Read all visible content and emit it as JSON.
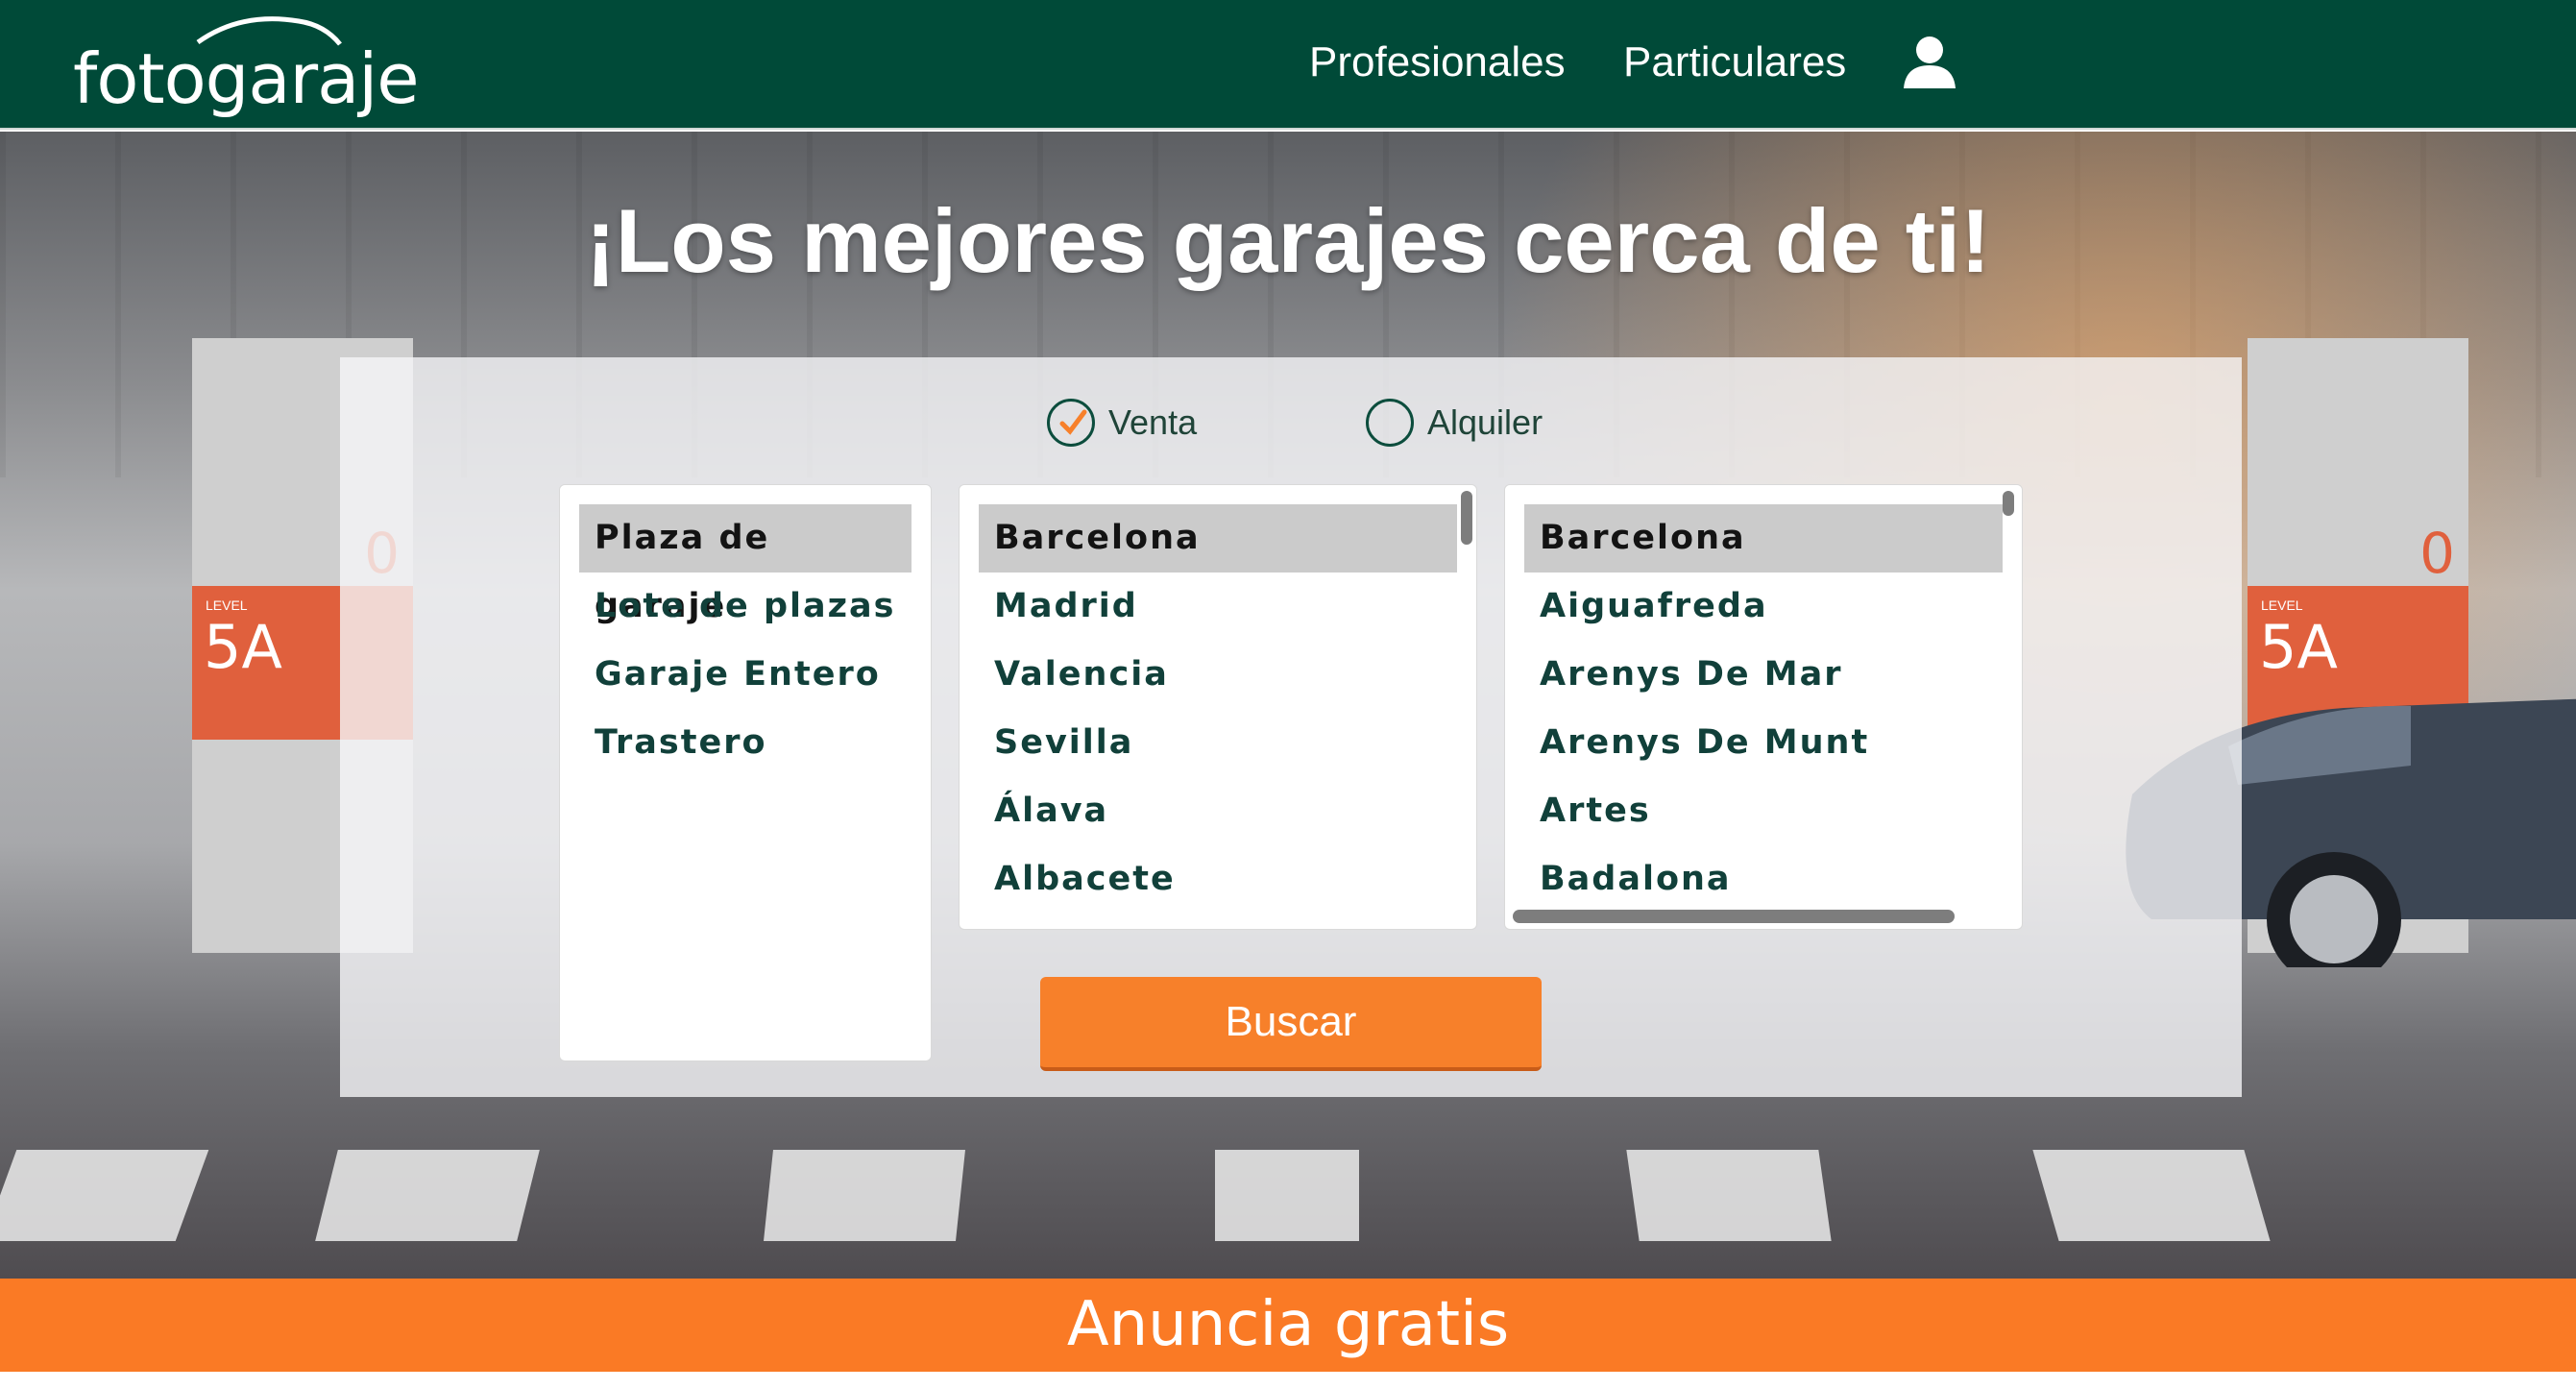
{
  "header": {
    "logo_text": "fotogaraje",
    "nav": [
      {
        "label": "Profesionales"
      },
      {
        "label": "Particulares"
      }
    ],
    "user_icon": "user-icon"
  },
  "hero": {
    "title": "¡Los mejores garajes cerca de ti!",
    "pillar_code": "5A",
    "pillar_level": "LEVEL",
    "pillar_zero": "0"
  },
  "search": {
    "operation": {
      "options": [
        {
          "label": "Venta",
          "checked": true
        },
        {
          "label": "Alquiler",
          "checked": false
        }
      ]
    },
    "types": {
      "items": [
        "Plaza de garaje",
        "Lote de plazas",
        "Garaje Entero",
        "Trastero"
      ],
      "selected": "Plaza de garaje"
    },
    "provinces": {
      "items": [
        "Barcelona",
        "Madrid",
        "Valencia",
        "Sevilla",
        "Álava",
        "Albacete"
      ],
      "selected": "Barcelona"
    },
    "cities": {
      "items": [
        "Barcelona",
        "Aiguafreda",
        "Arenys De Mar",
        "Arenys De Munt",
        "Artes",
        "Badalona"
      ],
      "selected": "Barcelona"
    },
    "button_label": "Buscar"
  },
  "cta": {
    "label": "Anuncia gratis"
  },
  "colors": {
    "header_bg": "#004a38",
    "accent_orange": "#f7802a",
    "text_dark_green": "#11403a"
  }
}
